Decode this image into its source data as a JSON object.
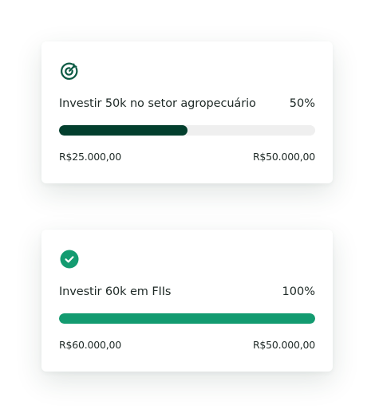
{
  "colors": {
    "accent_dark": "#033f2e",
    "accent_green": "#139b70",
    "track": "#efefef",
    "text": "#1f2a27"
  },
  "goals": [
    {
      "icon": "target-icon",
      "title": "Investir 50k no setor agropecuário",
      "percent_label": "50%",
      "progress": 0.5,
      "current_amount": "R$25.000,00",
      "target_amount": "R$50.000,00",
      "bar_color": "#033f2e"
    },
    {
      "icon": "check-circle-icon",
      "title": "Investir 60k em FIIs",
      "percent_label": "100%",
      "progress": 1.0,
      "current_amount": "R$60.000,00",
      "target_amount": "R$50.000,00",
      "bar_color": "#139b70"
    }
  ]
}
